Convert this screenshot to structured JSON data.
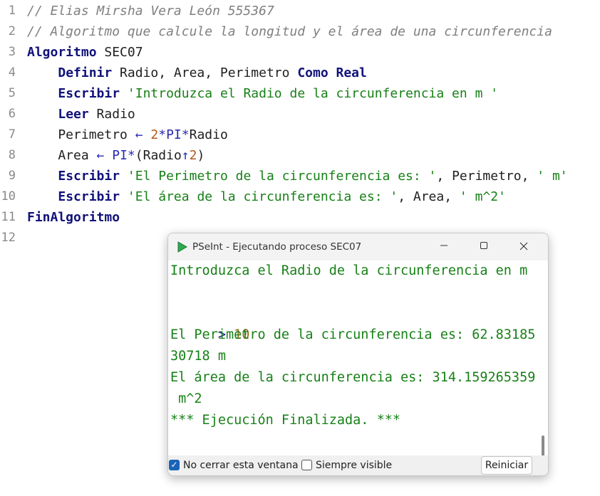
{
  "editor": {
    "lines": [
      {
        "n": "1",
        "parts": [
          {
            "t": "// Elias Mirsha Vera León 555367",
            "c": "cm"
          }
        ]
      },
      {
        "n": "2",
        "parts": [
          {
            "t": "// Algoritmo que calcule la longitud y el área de una circunferencia",
            "c": "cm"
          }
        ]
      },
      {
        "n": "3",
        "parts": [
          {
            "t": "Algoritmo",
            "c": "kw"
          },
          {
            "t": " SEC07",
            "c": ""
          }
        ]
      },
      {
        "n": "4",
        "parts": [
          {
            "t": "    ",
            "c": ""
          },
          {
            "t": "Definir",
            "c": "kw"
          },
          {
            "t": " Radio, Area, Perimetro ",
            "c": ""
          },
          {
            "t": "Como Real",
            "c": "kw"
          }
        ]
      },
      {
        "n": "5",
        "parts": [
          {
            "t": "    ",
            "c": ""
          },
          {
            "t": "Escribir",
            "c": "kw"
          },
          {
            "t": " ",
            "c": ""
          },
          {
            "t": "'Introduzca el Radio de la circunferencia en m '",
            "c": "str"
          }
        ]
      },
      {
        "n": "6",
        "parts": [
          {
            "t": "    ",
            "c": ""
          },
          {
            "t": "Leer",
            "c": "kw"
          },
          {
            "t": " Radio",
            "c": ""
          }
        ]
      },
      {
        "n": "7",
        "parts": [
          {
            "t": "    Perimetro ",
            "c": ""
          },
          {
            "t": "←",
            "c": "op"
          },
          {
            "t": " ",
            "c": ""
          },
          {
            "t": "2",
            "c": "num"
          },
          {
            "t": "*",
            "c": "op"
          },
          {
            "t": "PI",
            "c": "op"
          },
          {
            "t": "*",
            "c": "op"
          },
          {
            "t": "Radio",
            "c": ""
          }
        ]
      },
      {
        "n": "8",
        "parts": [
          {
            "t": "    Area ",
            "c": ""
          },
          {
            "t": "←",
            "c": "op"
          },
          {
            "t": " ",
            "c": ""
          },
          {
            "t": "PI",
            "c": "op"
          },
          {
            "t": "*",
            "c": "op"
          },
          {
            "t": "(Radio",
            "c": ""
          },
          {
            "t": "↑",
            "c": "op"
          },
          {
            "t": "2",
            "c": "num"
          },
          {
            "t": ")",
            "c": ""
          }
        ]
      },
      {
        "n": "9",
        "parts": [
          {
            "t": "    ",
            "c": ""
          },
          {
            "t": "Escribir",
            "c": "kw"
          },
          {
            "t": " ",
            "c": ""
          },
          {
            "t": "'El Perimetro de la circunferencia es: '",
            "c": "str"
          },
          {
            "t": ", Perimetro, ",
            "c": ""
          },
          {
            "t": "' m'",
            "c": "str"
          }
        ]
      },
      {
        "n": "10",
        "parts": [
          {
            "t": "    ",
            "c": ""
          },
          {
            "t": "Escribir",
            "c": "kw"
          },
          {
            "t": " ",
            "c": ""
          },
          {
            "t": "'El área de la circunferencia es: '",
            "c": "str"
          },
          {
            "t": ", Area, ",
            "c": ""
          },
          {
            "t": "' m^2'",
            "c": "str"
          }
        ]
      },
      {
        "n": "11",
        "parts": [
          {
            "t": "FinAlgoritmo",
            "c": "kw"
          }
        ]
      },
      {
        "n": "12",
        "parts": []
      }
    ]
  },
  "window": {
    "title": "PSeInt - Ejecutando proceso SEC07",
    "min_icon": "minimize-icon",
    "max_icon": "maximize-icon",
    "close_icon": "close-icon"
  },
  "console": {
    "line1": "Introduzca el Radio de la circunferencia en m",
    "prompt": ">",
    "input_value": "10",
    "line3": "El Perimetro de la circunferencia es: 62.83185",
    "line4": "30718 m",
    "line5": "El área de la circunferencia es: 314.159265359",
    "line6": " m^2",
    "line7": "*** Ejecución Finalizada. ***"
  },
  "bottom": {
    "keep_open_label": "No cerrar esta ventana",
    "keep_open_checked": true,
    "always_visible_label": "Siempre visible",
    "always_visible_checked": false,
    "restart_label": "Reiniciar"
  },
  "colors": {
    "keyword": "#11117a",
    "string": "#178017",
    "comment": "#7f7f7f",
    "number": "#b5561a",
    "operator": "#2a2ab0"
  }
}
